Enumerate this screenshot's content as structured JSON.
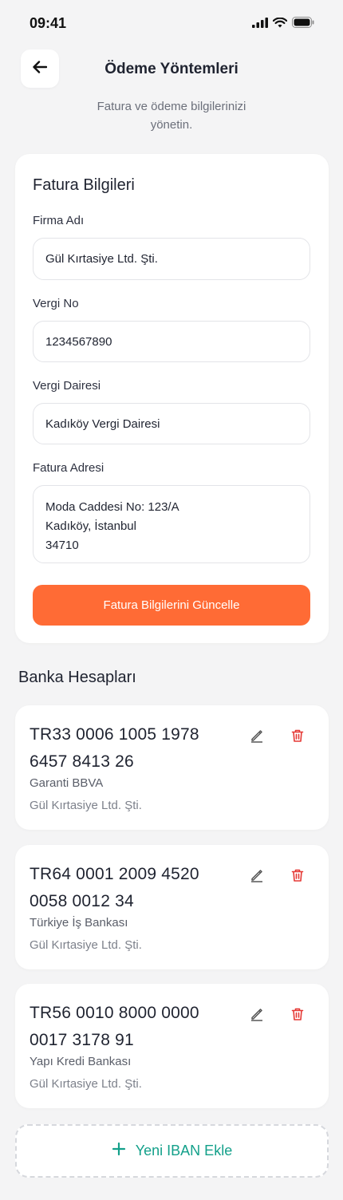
{
  "status_bar": {
    "time": "09:41"
  },
  "header": {
    "title": "Ödeme Yöntemleri",
    "subtitle": "Fatura ve ödeme bilgilerinizi yönetin."
  },
  "billing": {
    "title": "Fatura Bilgileri",
    "company_label": "Firma Adı",
    "company_value": "Gül Kırtasiye Ltd. Şti.",
    "tax_no_label": "Vergi No",
    "tax_no_value": "1234567890",
    "tax_office_label": "Vergi Dairesi",
    "tax_office_value": "Kadıköy Vergi Dairesi",
    "address_label": "Fatura Adresi",
    "address_value": "Moda Caddesi No: 123/A\nKadıköy, İstanbul\n34710",
    "update_button": "Fatura Bilgilerini Güncelle"
  },
  "bank": {
    "section_title": "Banka Hesapları",
    "accounts": [
      {
        "iban": "TR33 0006 1005 1978 6457 8413 26",
        "bank": "Garanti BBVA",
        "holder": "Gül Kırtasiye Ltd. Şti."
      },
      {
        "iban": "TR64 0001 2009 4520 0058 0012 34",
        "bank": "Türkiye İş Bankası",
        "holder": "Gül Kırtasiye Ltd. Şti."
      },
      {
        "iban": "TR56 0010 8000 0000 0017 3178 91",
        "bank": "Yapı Kredi Bankası",
        "holder": "Gül Kırtasiye Ltd. Şti."
      }
    ],
    "add_button": "Yeni IBAN Ekle"
  },
  "colors": {
    "accent": "#ff6b35",
    "add_accent": "#13a08a",
    "delete": "#e53935"
  },
  "icons": [
    "signal-icon",
    "wifi-icon",
    "battery-icon",
    "back-arrow-icon",
    "edit-icon",
    "trash-icon",
    "plus-icon"
  ]
}
